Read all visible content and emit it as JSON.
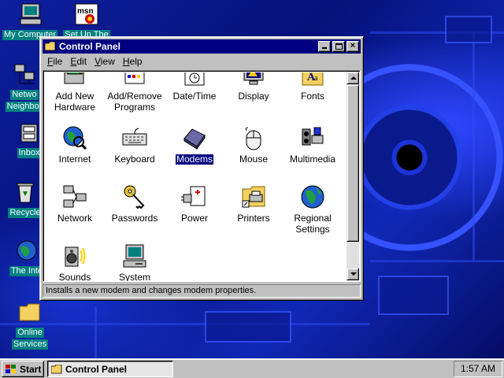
{
  "desktop": {
    "icons": [
      {
        "label": "My Computer",
        "icon": "my-computer-icon"
      },
      {
        "label": "Set Up The Microsoft Network",
        "visible_label": "Set Up The",
        "icon": "msn-icon"
      },
      {
        "label": "Network Neighborhood",
        "line1": "Netwo",
        "line2": "Neighbor",
        "icon": "network-neighborhood-icon"
      },
      {
        "label": "Inbox",
        "icon": "inbox-icon"
      },
      {
        "label": "Recycle Bin",
        "visible_label": "Recycle",
        "icon": "recycle-bin-icon"
      },
      {
        "label": "The Internet",
        "visible_label": "The Inte",
        "icon": "internet-icon"
      },
      {
        "label": "Online Services",
        "line1": "Online",
        "line2": "Services",
        "icon": "folder-icon"
      }
    ]
  },
  "window": {
    "title": "Control Panel",
    "buttons": {
      "minimize": "_",
      "maximize": "□",
      "close": "×"
    },
    "menu": [
      {
        "u": "F",
        "rest": "ile"
      },
      {
        "u": "E",
        "rest": "dit"
      },
      {
        "u": "V",
        "rest": "iew"
      },
      {
        "u": "H",
        "rest": "elp"
      }
    ],
    "items": [
      {
        "line1": "Add New",
        "line2": "Hardware",
        "icon": "add-hardware-icon"
      },
      {
        "line1": "Add/Remove",
        "line2": "Programs",
        "icon": "add-remove-programs-icon"
      },
      {
        "line1": "Date/Time",
        "line2": "",
        "icon": "date-time-icon"
      },
      {
        "line1": "Display",
        "line2": "",
        "icon": "display-icon"
      },
      {
        "line1": "Fonts",
        "line2": "",
        "icon": "fonts-icon"
      },
      {
        "line1": "Internet",
        "line2": "",
        "icon": "internet-icon"
      },
      {
        "line1": "Keyboard",
        "line2": "",
        "icon": "keyboard-icon"
      },
      {
        "line1": "Modems",
        "line2": "",
        "icon": "modem-icon",
        "selected": true
      },
      {
        "line1": "Mouse",
        "line2": "",
        "icon": "mouse-icon"
      },
      {
        "line1": "Multimedia",
        "line2": "",
        "icon": "multimedia-icon"
      },
      {
        "line1": "Network",
        "line2": "",
        "icon": "network-icon"
      },
      {
        "line1": "Passwords",
        "line2": "",
        "icon": "passwords-icon"
      },
      {
        "line1": "Power",
        "line2": "",
        "icon": "power-icon"
      },
      {
        "line1": "Printers",
        "line2": "",
        "icon": "printers-folder-icon"
      },
      {
        "line1": "Regional",
        "line2": "Settings",
        "icon": "regional-settings-icon"
      },
      {
        "line1": "Sounds",
        "line2": "",
        "icon": "sounds-icon"
      },
      {
        "line1": "System",
        "line2": "",
        "icon": "system-icon"
      }
    ],
    "status": "Installs a new modem and changes modem properties."
  },
  "taskbar": {
    "start_label": "Start",
    "task_label": "Control Panel",
    "clock": "1:57 AM"
  },
  "colors": {
    "title_bar": "#000080",
    "desktop": "#0a1a8c",
    "face": "#c0c0c0",
    "selection": "#000080"
  }
}
